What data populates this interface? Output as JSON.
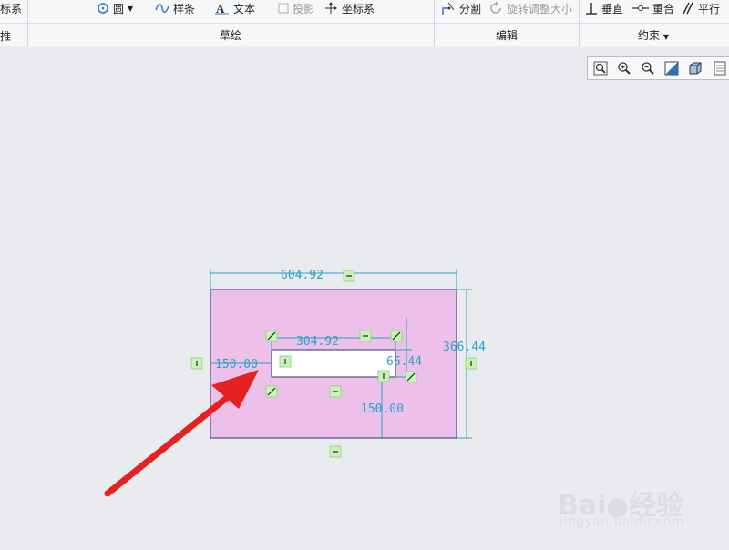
{
  "ribbon": {
    "left_fragment_top": "标系",
    "left_fragment_bottom": "推",
    "sketch_tools": {
      "circle_label": "圆",
      "spline_label": "样条",
      "text_label": "文本",
      "project_label": "投影",
      "coord_label": "坐标系"
    },
    "edit_tools": {
      "divide_label": "分割",
      "rotate_resize_label": "旋转调整大小"
    },
    "constraint_tools": {
      "vertical_label": "垂直",
      "coincident_label": "重合",
      "parallel_label": "平行"
    },
    "groups": {
      "sketch": "草绘",
      "edit": "编辑",
      "constraint": "约束"
    }
  },
  "view_toolbar": {
    "icons": [
      "refit-icon",
      "zoom-in-icon",
      "zoom-out-icon",
      "repaint-icon",
      "display-style-icon",
      "saved-views-icon"
    ]
  },
  "sketch": {
    "dim_outer_width": "604.92",
    "dim_outer_height": "366.44",
    "dim_inner_width": "304.92",
    "dim_inner_height": "66.44",
    "dim_left_offset": "150.00",
    "dim_bottom_offset": "150.00",
    "colors": {
      "fill": "#edc0e9",
      "outline": "#2f2f7a",
      "dimension": "#27a3c8",
      "constraint_bg": "#c7f2b8",
      "arrow": "#e42222"
    }
  },
  "watermark": {
    "brand": "Bai",
    "brand_suffix": "经验",
    "url": "jingyan.baidu.com"
  }
}
